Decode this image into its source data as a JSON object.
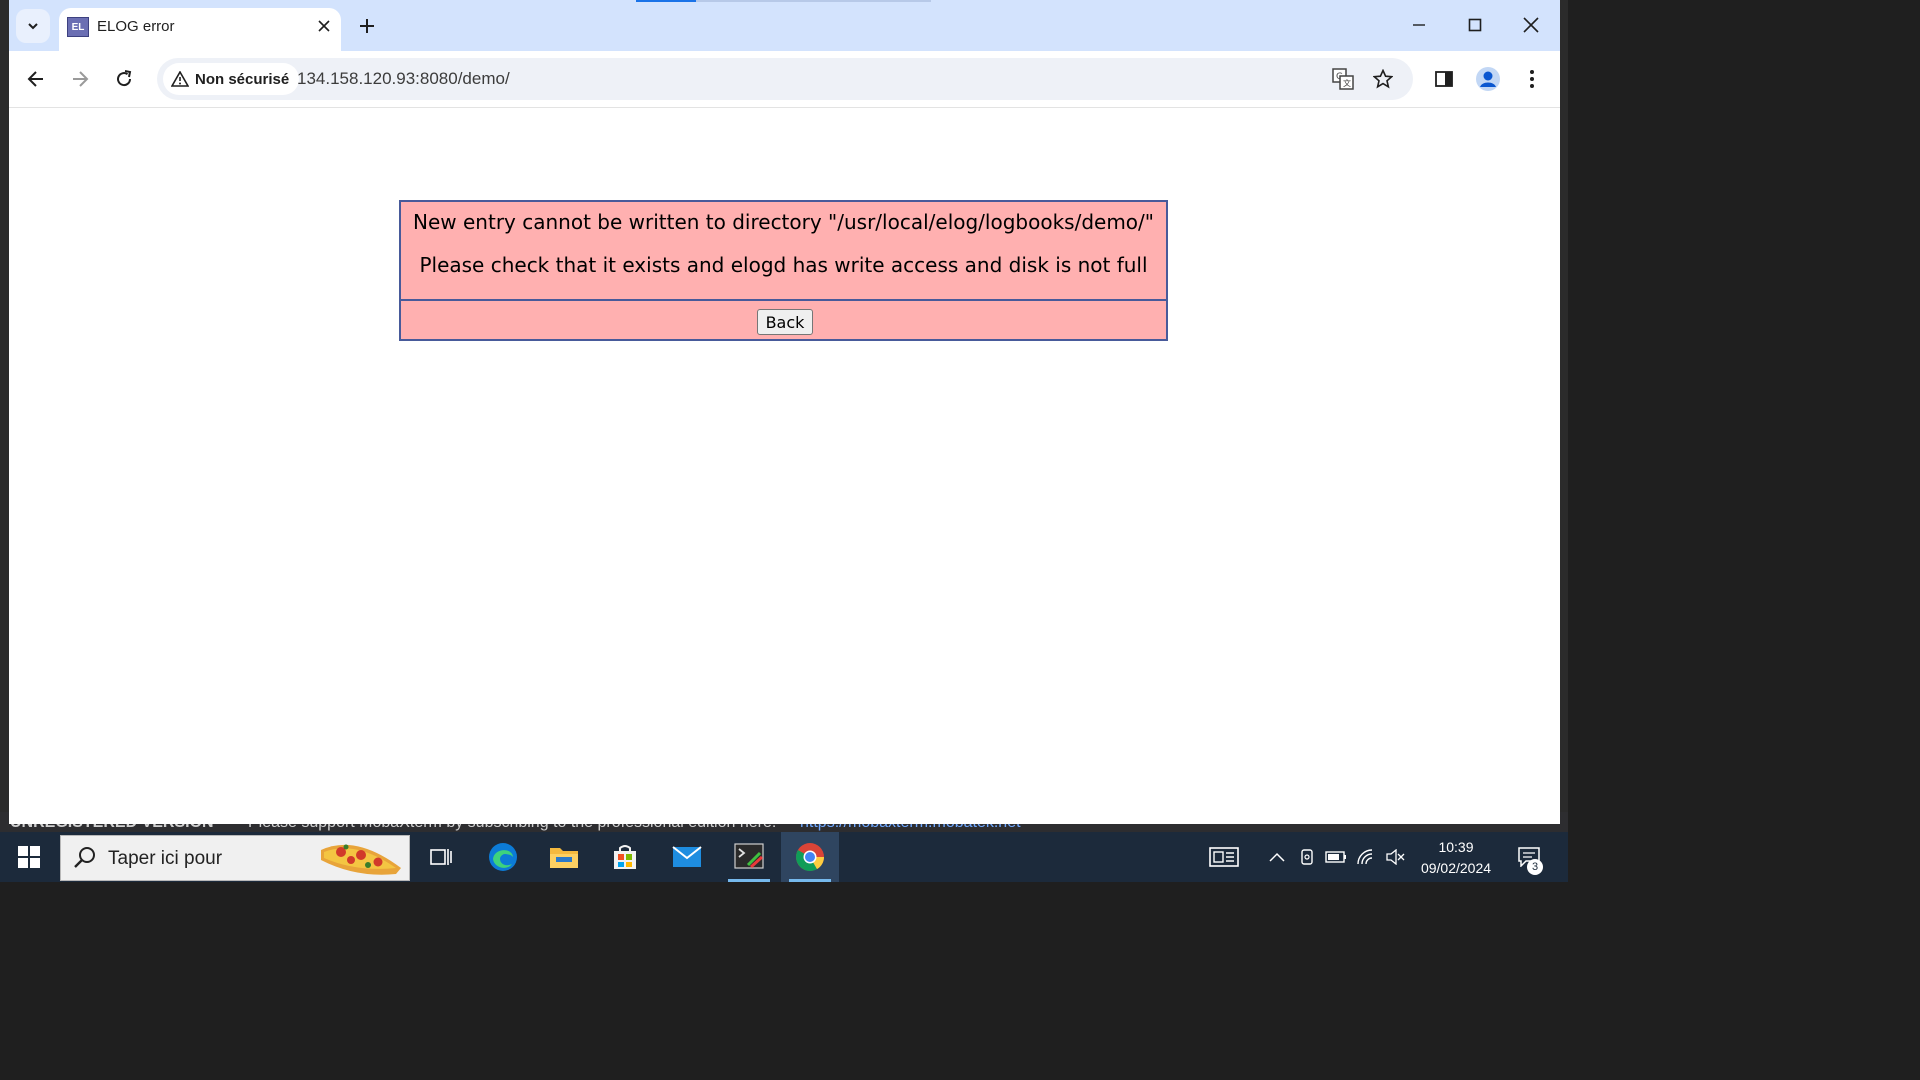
{
  "background_app": {
    "unregistered_label": "UNREGISTERED VERSION",
    "support_text": "Please support MobaXterm by subscribing to the professional edition here:",
    "support_link": "https://mobaxterm.mobatek.net"
  },
  "browser": {
    "tab": {
      "favicon_text": "EL",
      "title": "ELOG error"
    },
    "omnibox": {
      "security_label": "Non sécurisé",
      "url": "134.158.120.93:8080/demo/"
    }
  },
  "page": {
    "error_line_1": "New entry cannot be written to directory \"/usr/local/elog/logbooks/demo/\"",
    "error_line_2": "Please check that it exists and elogd has write access and disk is not full",
    "back_label": "Back",
    "colors": {
      "box_background": "#ffb0b0",
      "box_border": "#485a9a"
    }
  },
  "taskbar": {
    "search_placeholder": "Taper ici pour",
    "clock_time": "10:39",
    "clock_date": "09/02/2024",
    "notification_count": "3",
    "pinned": [
      "task-view",
      "edge",
      "file-explorer",
      "microsoft-store",
      "mail",
      "mobaxterm",
      "chrome"
    ]
  }
}
